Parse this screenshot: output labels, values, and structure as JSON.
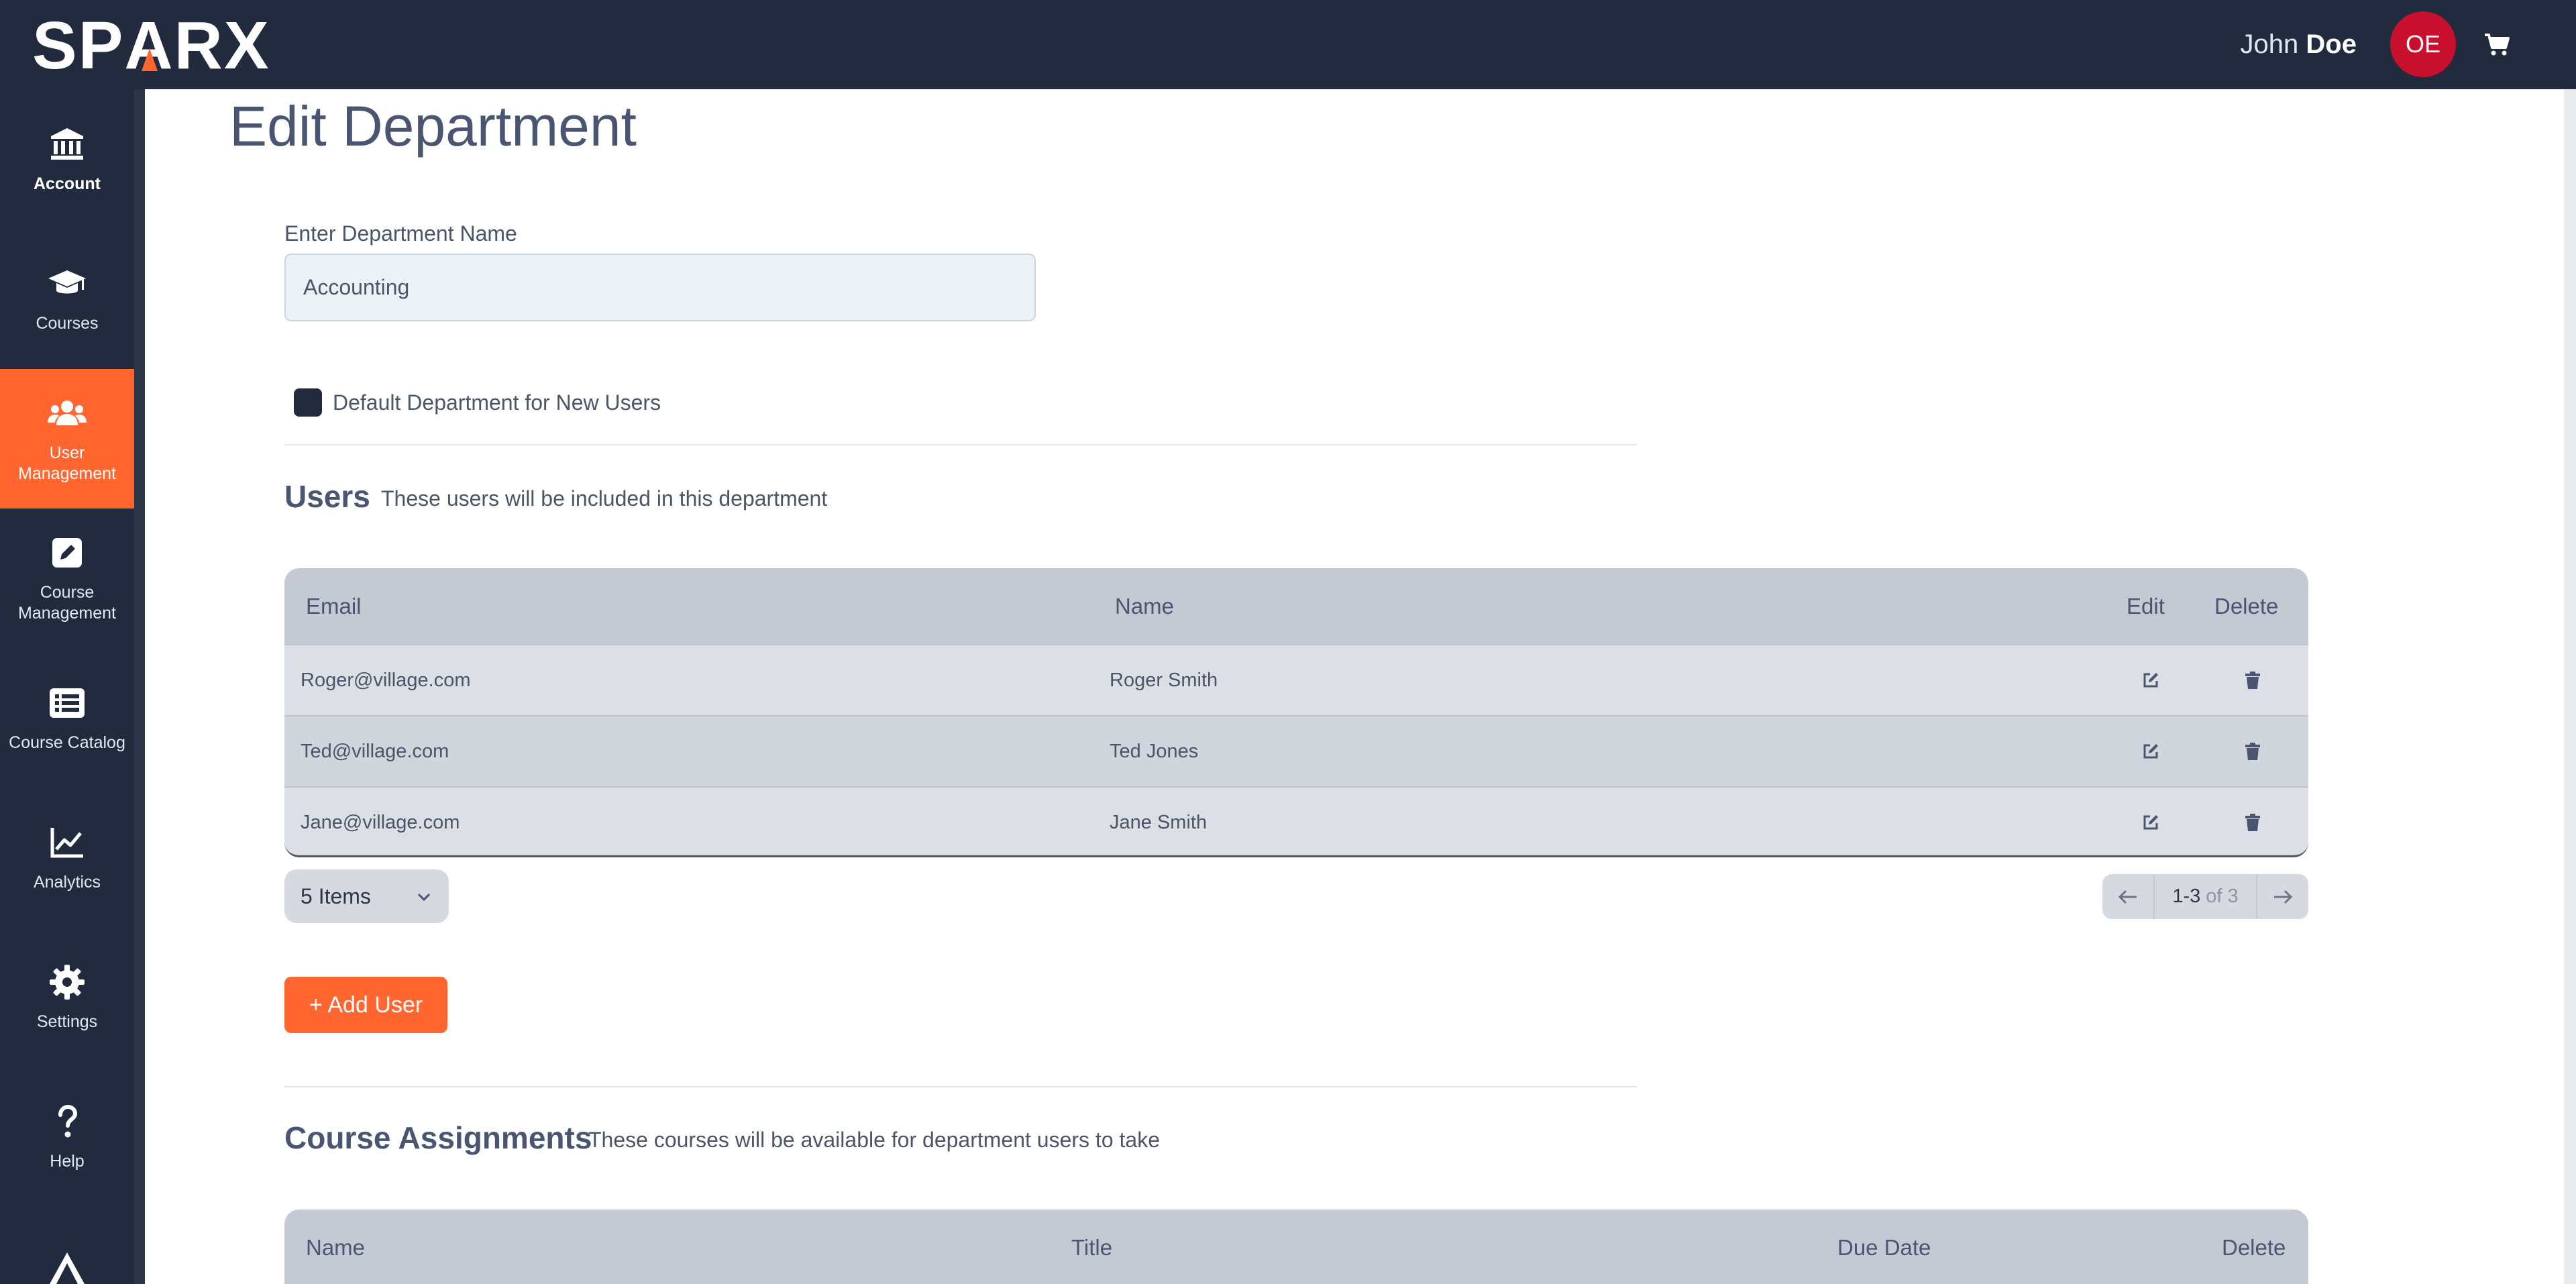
{
  "brand": {
    "logo_text_left": "SP",
    "logo_text_a": "A",
    "logo_text_right": "RX",
    "accent_color": "#ff6630",
    "nav_bg": "#222a3d"
  },
  "header": {
    "user_first": "John",
    "user_last": "Doe",
    "avatar_initials": "OE",
    "avatar_color": "#c8102e",
    "cart_icon": "cart-icon"
  },
  "sidebar": {
    "items": [
      {
        "label": "Account",
        "icon": "bank-icon"
      },
      {
        "label": "Courses",
        "icon": "graduation-cap-icon"
      },
      {
        "label": "User\nManagement",
        "icon": "users-icon",
        "active": true
      },
      {
        "label": "Course\nManagement",
        "icon": "edit-square-icon"
      },
      {
        "label": "Course Catalog",
        "icon": "list-icon"
      },
      {
        "label": "Analytics",
        "icon": "line-chart-icon"
      },
      {
        "label": "Settings",
        "icon": "gear-icon"
      },
      {
        "label": "Help",
        "icon": "question-icon"
      }
    ]
  },
  "page": {
    "title": "Edit Department",
    "name_label": "Enter Department Name",
    "name_value": "Accounting",
    "default_checkbox_label": "Default Department for New Users",
    "default_checked": false
  },
  "users": {
    "title": "Users",
    "subtitle": "These users will be included in this department",
    "columns": {
      "email": "Email",
      "name": "Name",
      "edit": "Edit",
      "delete": "Delete"
    },
    "rows": [
      {
        "email": "Roger@village.com",
        "name": "Roger Smith"
      },
      {
        "email": "Ted@village.com",
        "name": "Ted Jones"
      },
      {
        "email": "Jane@village.com",
        "name": "Jane Smith"
      }
    ],
    "page_size_label": "5 Items",
    "pager_range": "1-3",
    "pager_of": "of 3",
    "add_button": "+ Add User"
  },
  "course_assignments": {
    "title": "Course Assignments",
    "subtitle": "These courses will be available for department users to take",
    "columns": {
      "name": "Name",
      "title": "Title",
      "due_date": "Due Date",
      "delete": "Delete"
    }
  }
}
